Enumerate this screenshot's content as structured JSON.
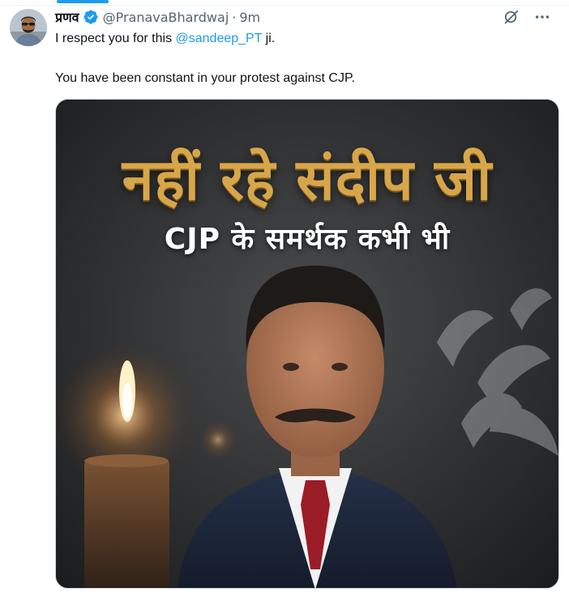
{
  "tweet": {
    "display_name": "प्रणव",
    "handle": "@PranavaBhardwaj",
    "separator": "·",
    "time": "9m",
    "line1_prefix": "I respect you for this ",
    "line1_mention": "@sandeep_PT",
    "line1_suffix": " ji.",
    "line2": "You have been constant in your protest against CJP."
  },
  "media": {
    "headline": "नहीं रहे संदीप जी",
    "subline": "CJP के समर्थक कभी भी"
  },
  "icons": {
    "verified": "verified-badge-icon",
    "grok": "grok-icon",
    "more": "more-icon"
  },
  "colors": {
    "accent": "#1d9bf0",
    "text": "#0f1419",
    "secondary": "#536471",
    "headline_gold": "#d8a64a"
  }
}
